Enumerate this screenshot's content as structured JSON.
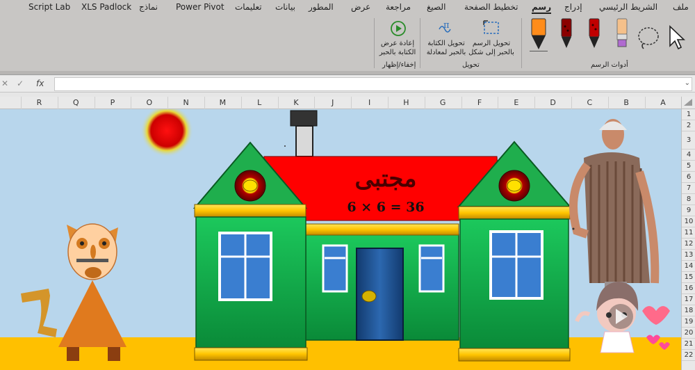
{
  "ribbon": {
    "tabs": [
      {
        "label": "ملف",
        "active": false
      },
      {
        "label": "الشريط الرئيسي",
        "active": false
      },
      {
        "label": "إدراج",
        "active": false
      },
      {
        "label": "رسم",
        "active": true
      },
      {
        "label": "تخطيط الصفحة",
        "active": false
      },
      {
        "label": "الصيغ",
        "active": false
      },
      {
        "label": "مراجعة",
        "active": false
      },
      {
        "label": "عرض",
        "active": false
      },
      {
        "label": "المطور",
        "active": false
      },
      {
        "label": "بيانات",
        "active": false
      },
      {
        "label": "تعليمات",
        "active": false
      },
      {
        "label": "Power Pivot",
        "active": false
      },
      {
        "label": "نماذج",
        "active": false
      },
      {
        "label": "XLS Padlock",
        "active": false
      },
      {
        "label": "Script Lab",
        "active": false
      }
    ],
    "groups": {
      "drawing_tools": "أدوات الرسم",
      "convert": "تحويل",
      "show_hide": "إخفاء/إظهار"
    },
    "buttons": {
      "ink_to_shape_line1": "تحويل الرسم",
      "ink_to_shape_line2": "بالحبر إلى شكل",
      "ink_to_math_line1": "تحويل الكتابة",
      "ink_to_math_line2": "بالحبر لمعادلة",
      "ink_replay_line1": "إعادة عرض",
      "ink_replay_line2": "الكتابة بالحبر"
    },
    "pens": [
      {
        "name": "highlighter-purple-icon",
        "color": "#b06ad0"
      },
      {
        "name": "pen-red-icon",
        "color": "#c00000"
      },
      {
        "name": "pen-darkred-icon",
        "color": "#8b0000"
      },
      {
        "name": "highlighter-orange-icon",
        "color": "#ff8c1a"
      }
    ]
  },
  "formula_bar": {
    "cancel": "✕",
    "enter": "✓",
    "fx": "fx",
    "value": ""
  },
  "columns": [
    "A",
    "B",
    "C",
    "D",
    "E",
    "F",
    "G",
    "H",
    "I",
    "J",
    "K",
    "L",
    "M",
    "N",
    "O",
    "P",
    "Q",
    "R"
  ],
  "rows": [
    "1",
    "2",
    "3",
    "4",
    "5",
    "6",
    "7",
    "8",
    "9",
    "10",
    "11",
    "12",
    "13",
    "14",
    "15",
    "16",
    "17",
    "18",
    "19",
    "20",
    "21",
    "22"
  ],
  "drawing": {
    "roof_sign": "مجتبى",
    "equation": "6 × 6 = 36",
    "colors": {
      "sky": "#b8d6ec",
      "ground": "#ffc000",
      "wall_green": "#12a54a",
      "roof_red": "#ff0000",
      "gable_green": "#1fae4d",
      "trim_yellow": "#ffd200",
      "door_blue": "#1f4f8f",
      "sun": "#e00000"
    }
  }
}
